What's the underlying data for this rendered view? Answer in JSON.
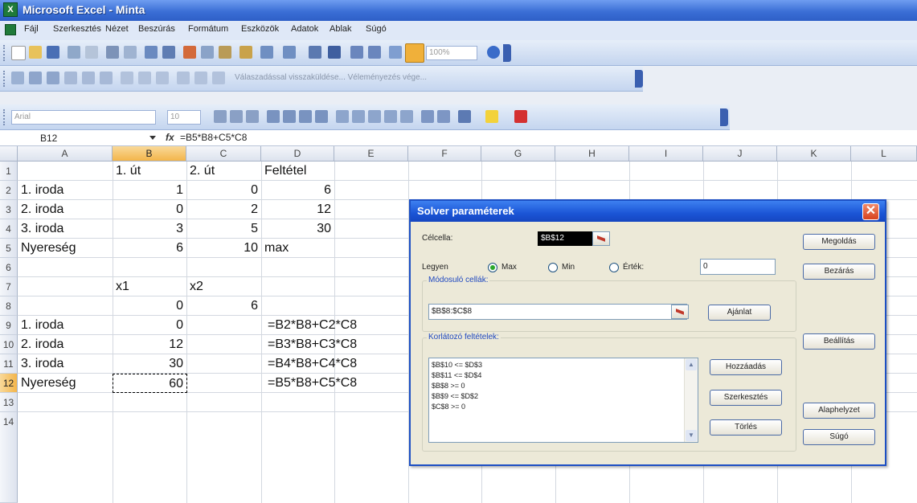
{
  "window": {
    "title": "Microsoft Excel - Minta"
  },
  "menu": [
    "Fájl",
    "Szerkesztés",
    "Nézet",
    "Beszúrás",
    "Formátum",
    "Eszközök",
    "Adatok",
    "Ablak",
    "Súgó"
  ],
  "toolbar2": {
    "review_text": "Válaszadással visszaküldése...  Véleményezés vége..."
  },
  "toolbar1": {
    "zoom": "100%"
  },
  "format_toolbar": {
    "font": "Arial",
    "size": "10"
  },
  "formula_bar": {
    "name_box": "B12",
    "fx": "fx",
    "formula": "=B5*B8+C5*C8"
  },
  "columns": [
    "A",
    "B",
    "C",
    "D",
    "E",
    "F",
    "G",
    "H",
    "I",
    "J",
    "K",
    "L"
  ],
  "rows": [
    "1",
    "2",
    "3",
    "4",
    "5",
    "6",
    "7",
    "8",
    "9",
    "10",
    "11",
    "12",
    "13",
    "14"
  ],
  "cells": {
    "B1": "1. út",
    "C1": "2. út",
    "D1": "Feltétel",
    "A2": "1. iroda",
    "B2": "1",
    "C2": "0",
    "D2": "6",
    "A3": "2. iroda",
    "B3": "0",
    "C3": "2",
    "D3": "12",
    "A4": "3. iroda",
    "B4": "3",
    "C4": "5",
    "D4": "30",
    "A5": "Nyereség",
    "B5": "6",
    "C5": "10",
    "D5": "max",
    "B7": "x1",
    "C7": "x2",
    "B8": "0",
    "C8": "6",
    "A9": "1. iroda",
    "B9": "0",
    "D9": "=B2*B8+C2*C8",
    "A10": "2. iroda",
    "B10": "12",
    "D10": "=B3*B8+C3*C8",
    "A11": "3. iroda",
    "B11": "30",
    "D11": "=B4*B8+C4*C8",
    "A12": "Nyereség",
    "B12": "60",
    "D12": "=B5*B8+C5*C8"
  },
  "solver": {
    "title": "Solver paraméterek",
    "target_label": "Célcella:",
    "target_value": "$B$12",
    "equal_label": "Legyen",
    "opt_max": "Max",
    "opt_min": "Min",
    "opt_value": "Érték:",
    "value_input": "0",
    "changing_label": "Módosuló cellák:",
    "changing_value": "$B$8:$C$8",
    "guess_btn": "Ajánlat",
    "constraints_label": "Korlátozó feltételek:",
    "constraints": [
      "$B$10 <= $D$3",
      "$B$11 <= $D$4",
      "$B$8 >= 0",
      "$B$9 <= $D$2",
      "$C$8 >= 0"
    ],
    "add_btn": "Hozzáadás",
    "change_btn": "Szerkesztés",
    "delete_btn": "Törlés",
    "solve_btn": "Megoldás",
    "close_btn": "Bezárás",
    "options_btn": "Beállítás",
    "reset_btn": "Alaphelyzet",
    "help_btn": "Súgó"
  }
}
